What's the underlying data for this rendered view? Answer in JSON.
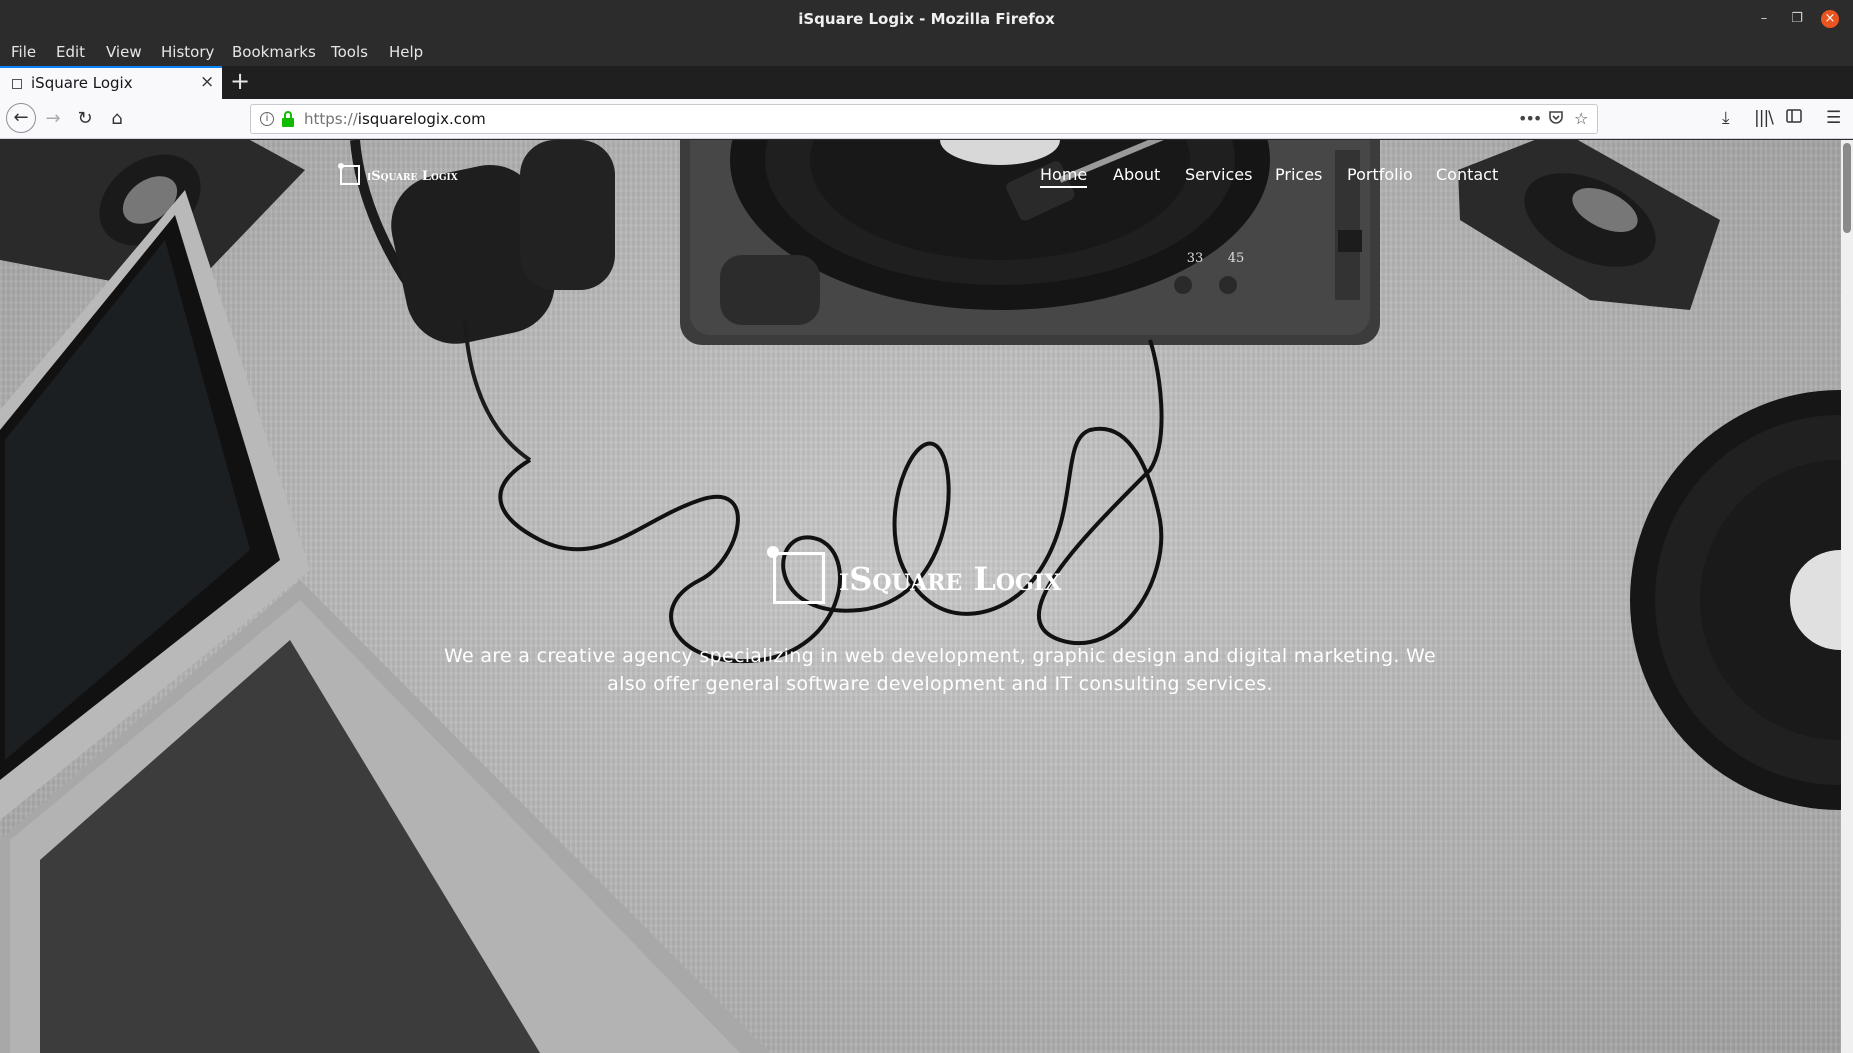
{
  "window": {
    "title": "iSquare Logix - Mozilla Firefox"
  },
  "menu": {
    "items": [
      "File",
      "Edit",
      "View",
      "History",
      "Bookmarks",
      "Tools",
      "Help"
    ]
  },
  "tab": {
    "label": "iSquare Logix",
    "close_icon": "close-icon"
  },
  "navbar": {
    "url_scheme": "https://",
    "url_host": "isquarelogix.com",
    "page_actions": "•••",
    "icons": [
      "back-icon",
      "forward-icon",
      "reload-icon",
      "home-icon",
      "info-icon",
      "lock-icon",
      "pocket-icon",
      "bookmark-star-icon",
      "download-icon",
      "library-icon",
      "sidebar-icon",
      "menu-icon"
    ]
  },
  "site": {
    "logo_text": "iSquare Logix",
    "nav": [
      "Home",
      "About",
      "Services",
      "Prices",
      "Portfolio",
      "Contact"
    ],
    "active_nav": "Home",
    "hero_logo_text": "iSquare Logix",
    "hero_text": "We are a creative agency specializing in web development, graphic design and digital marketing. We also offer general software development and IT consulting services.",
    "turntable_speeds": [
      "33",
      "45"
    ]
  },
  "colors": {
    "titlebar_bg": "#2c2c2c",
    "close_button": "#e95420",
    "tab_accent": "#0a84ff",
    "lock_green": "#12bc00"
  }
}
